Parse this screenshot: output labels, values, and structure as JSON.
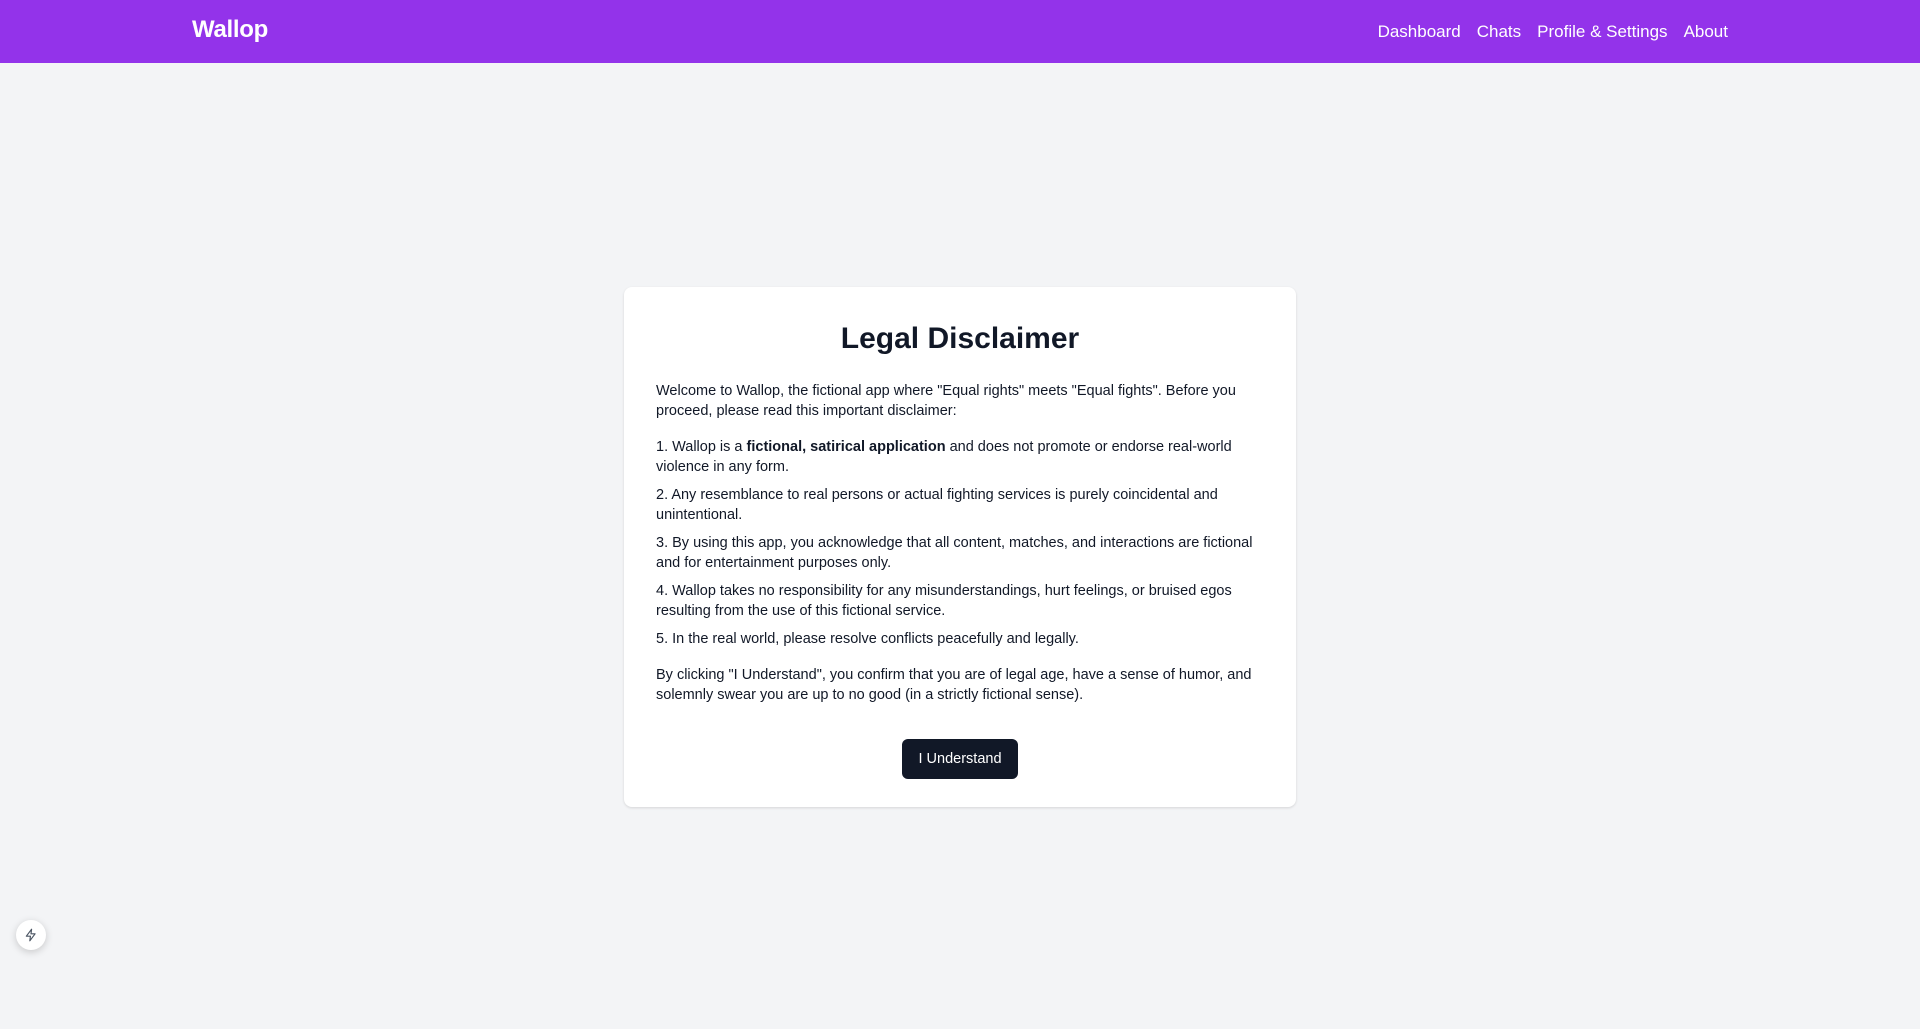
{
  "navbar": {
    "brand": "Wallop",
    "links": [
      "Dashboard",
      "Chats",
      "Profile & Settings",
      "About"
    ],
    "background_color": "#9333ea"
  },
  "card": {
    "title": "Legal Disclaimer",
    "intro": "Welcome to Wallop, the fictional app where \"Equal rights\" meets \"Equal fights\". Before you proceed, please read this important disclaimer:",
    "items": [
      {
        "prefix": "1. Wallop is a ",
        "bold": "fictional, satirical application",
        "suffix": " and does not promote or endorse real-world violence in any form."
      },
      {
        "text": "2. Any resemblance to real persons or actual fighting services is purely coincidental and unintentional."
      },
      {
        "text": "3. By using this app, you acknowledge that all content, matches, and interactions are fictional and for entertainment purposes only."
      },
      {
        "text": "4. Wallop takes no responsibility for any misunderstandings, hurt feelings, or bruised egos resulting from the use of this fictional service."
      },
      {
        "text": "5. In the real world, please resolve conflicts peacefully and legally."
      }
    ],
    "outro": "By clicking \"I Understand\", you confirm that you are of legal age, have a sense of humor, and solemnly swear you are up to no good (in a strictly fictional sense).",
    "button_label": "I Understand"
  },
  "floating_button": {
    "icon": "lightning-bolt-icon"
  }
}
